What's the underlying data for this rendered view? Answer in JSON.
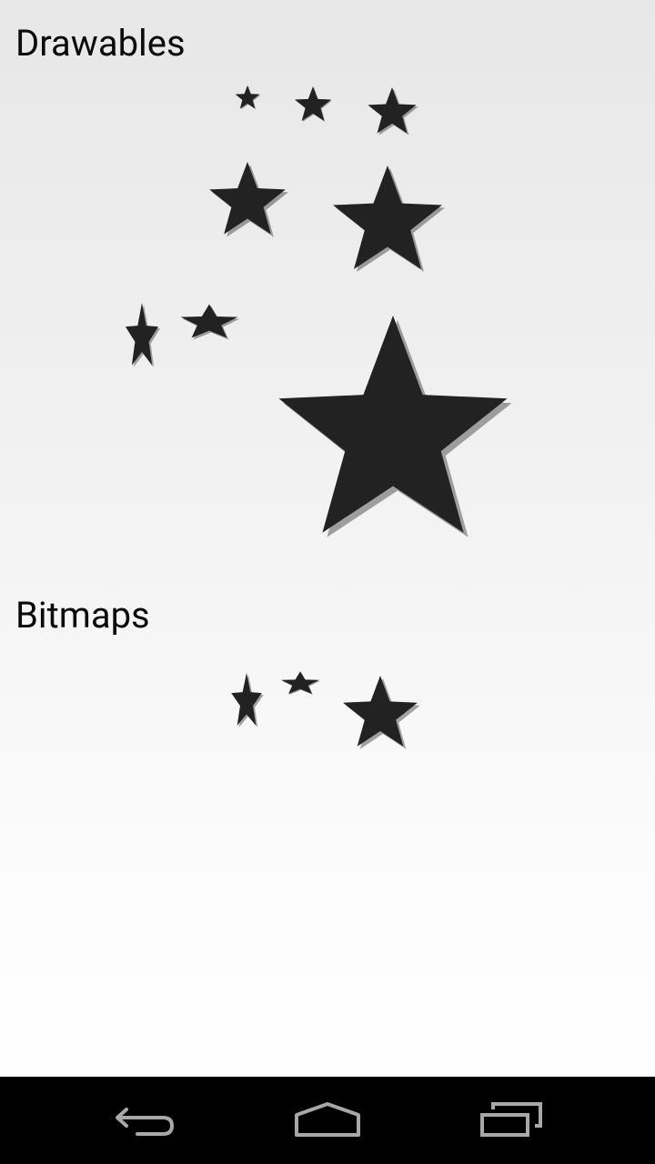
{
  "sections": {
    "drawables": {
      "title": "Drawables"
    },
    "bitmaps": {
      "title": "Bitmaps"
    }
  },
  "colors": {
    "star_fill": "#222222",
    "navbar_background": "#000000",
    "navbar_icon": "#a8a8a8"
  },
  "navbar": {
    "back_icon": "back-arrow-icon",
    "home_icon": "home-icon",
    "recents_icon": "recent-apps-icon"
  }
}
